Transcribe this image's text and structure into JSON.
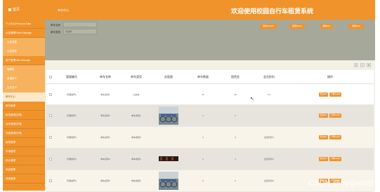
{
  "header": {
    "home_label": "首页",
    "breadcrumb": "单车中心",
    "title": "欢迎使用校园自行车租赁系统"
  },
  "sidebar": {
    "items": [
      {
        "label": "个人中心Personal Data",
        "type": "group"
      },
      {
        "label": "公告管理Public Manage",
        "type": "group"
      },
      {
        "label": "公告信息",
        "type": "sub"
      },
      {
        "label": "公告类型",
        "type": "sub"
      },
      {
        "label": "用户管理User Manage",
        "type": "group"
      },
      {
        "label": "管理员",
        "type": "sub"
      },
      {
        "label": "普通用户",
        "type": "sub"
      },
      {
        "label": "会员用户",
        "type": "sub"
      },
      {
        "label": "单车中心",
        "type": "active"
      },
      {
        "label": "单车管理",
        "type": "group"
      },
      {
        "label": "租赁管理(详情)",
        "type": "group"
      },
      {
        "label": "还车管理(详情)",
        "type": "group"
      },
      {
        "label": "充值管理(详情)",
        "type": "group"
      },
      {
        "label": "维修管理",
        "type": "group"
      },
      {
        "label": "车辆管理",
        "type": "group"
      },
      {
        "label": "统计管理",
        "type": "group"
      },
      {
        "label": "系统管理",
        "type": "group"
      },
      {
        "label": "其他管理",
        "type": "group"
      }
    ]
  },
  "search": {
    "name_label": "单车名称",
    "name_placeholder": "",
    "type_label": "单车类型",
    "type_value": "请选择",
    "buttons": [
      "查询Search",
      "重置Reset",
      "删除Del",
      "新增Add"
    ]
  },
  "toolbar": {
    "icons": [
      "filter-icon",
      "print-icon",
      "settings-icon"
    ]
  },
  "table": {
    "columns": [
      "",
      "管理编号",
      "单车名称",
      "单车类型",
      "封面图",
      "单车数量",
      "租赁金",
      "会员折扣",
      "操作"
    ],
    "rows": [
      {
        "code": "管理编号1",
        "name": "单车名称1",
        "type": "山地车",
        "image": "none",
        "qty": "10",
        "price": "38",
        "discount": "0.1",
        "ops": [
          "修改Edit",
          "详情Details"
        ]
      },
      {
        "code": "管理编号2",
        "name": "单车名称2",
        "type": "单车类型2",
        "image": "bike",
        "qty": "2",
        "price": "2",
        "discount": "",
        "ops": [
          "修改Edit",
          "详情Details"
        ]
      },
      {
        "code": "管理编号3",
        "name": "单车名称3",
        "type": "单车类型3",
        "image": "none",
        "qty": "3",
        "price": "3",
        "discount": "会员折扣3",
        "ops": [
          "修改Edit",
          "详情Details"
        ]
      },
      {
        "code": "管理编号4",
        "name": "单车名称4",
        "type": "单车类型4",
        "image": "dark",
        "qty": "4",
        "price": "4",
        "discount": "会员折扣4",
        "ops": [
          "修改Edit",
          "详情Details"
        ]
      },
      {
        "code": "管理编号5",
        "name": "单车名称5",
        "type": "单车类型5",
        "image": "bike",
        "qty": "5",
        "price": "5",
        "discount": "会员折扣5",
        "ops": [
          "修改Edit",
          "详情Details"
        ]
      }
    ]
  },
  "watermark": "CSDN @bysjlw985",
  "colors": {
    "accent": "#f0932b",
    "search_bg": "#a6a89a"
  }
}
